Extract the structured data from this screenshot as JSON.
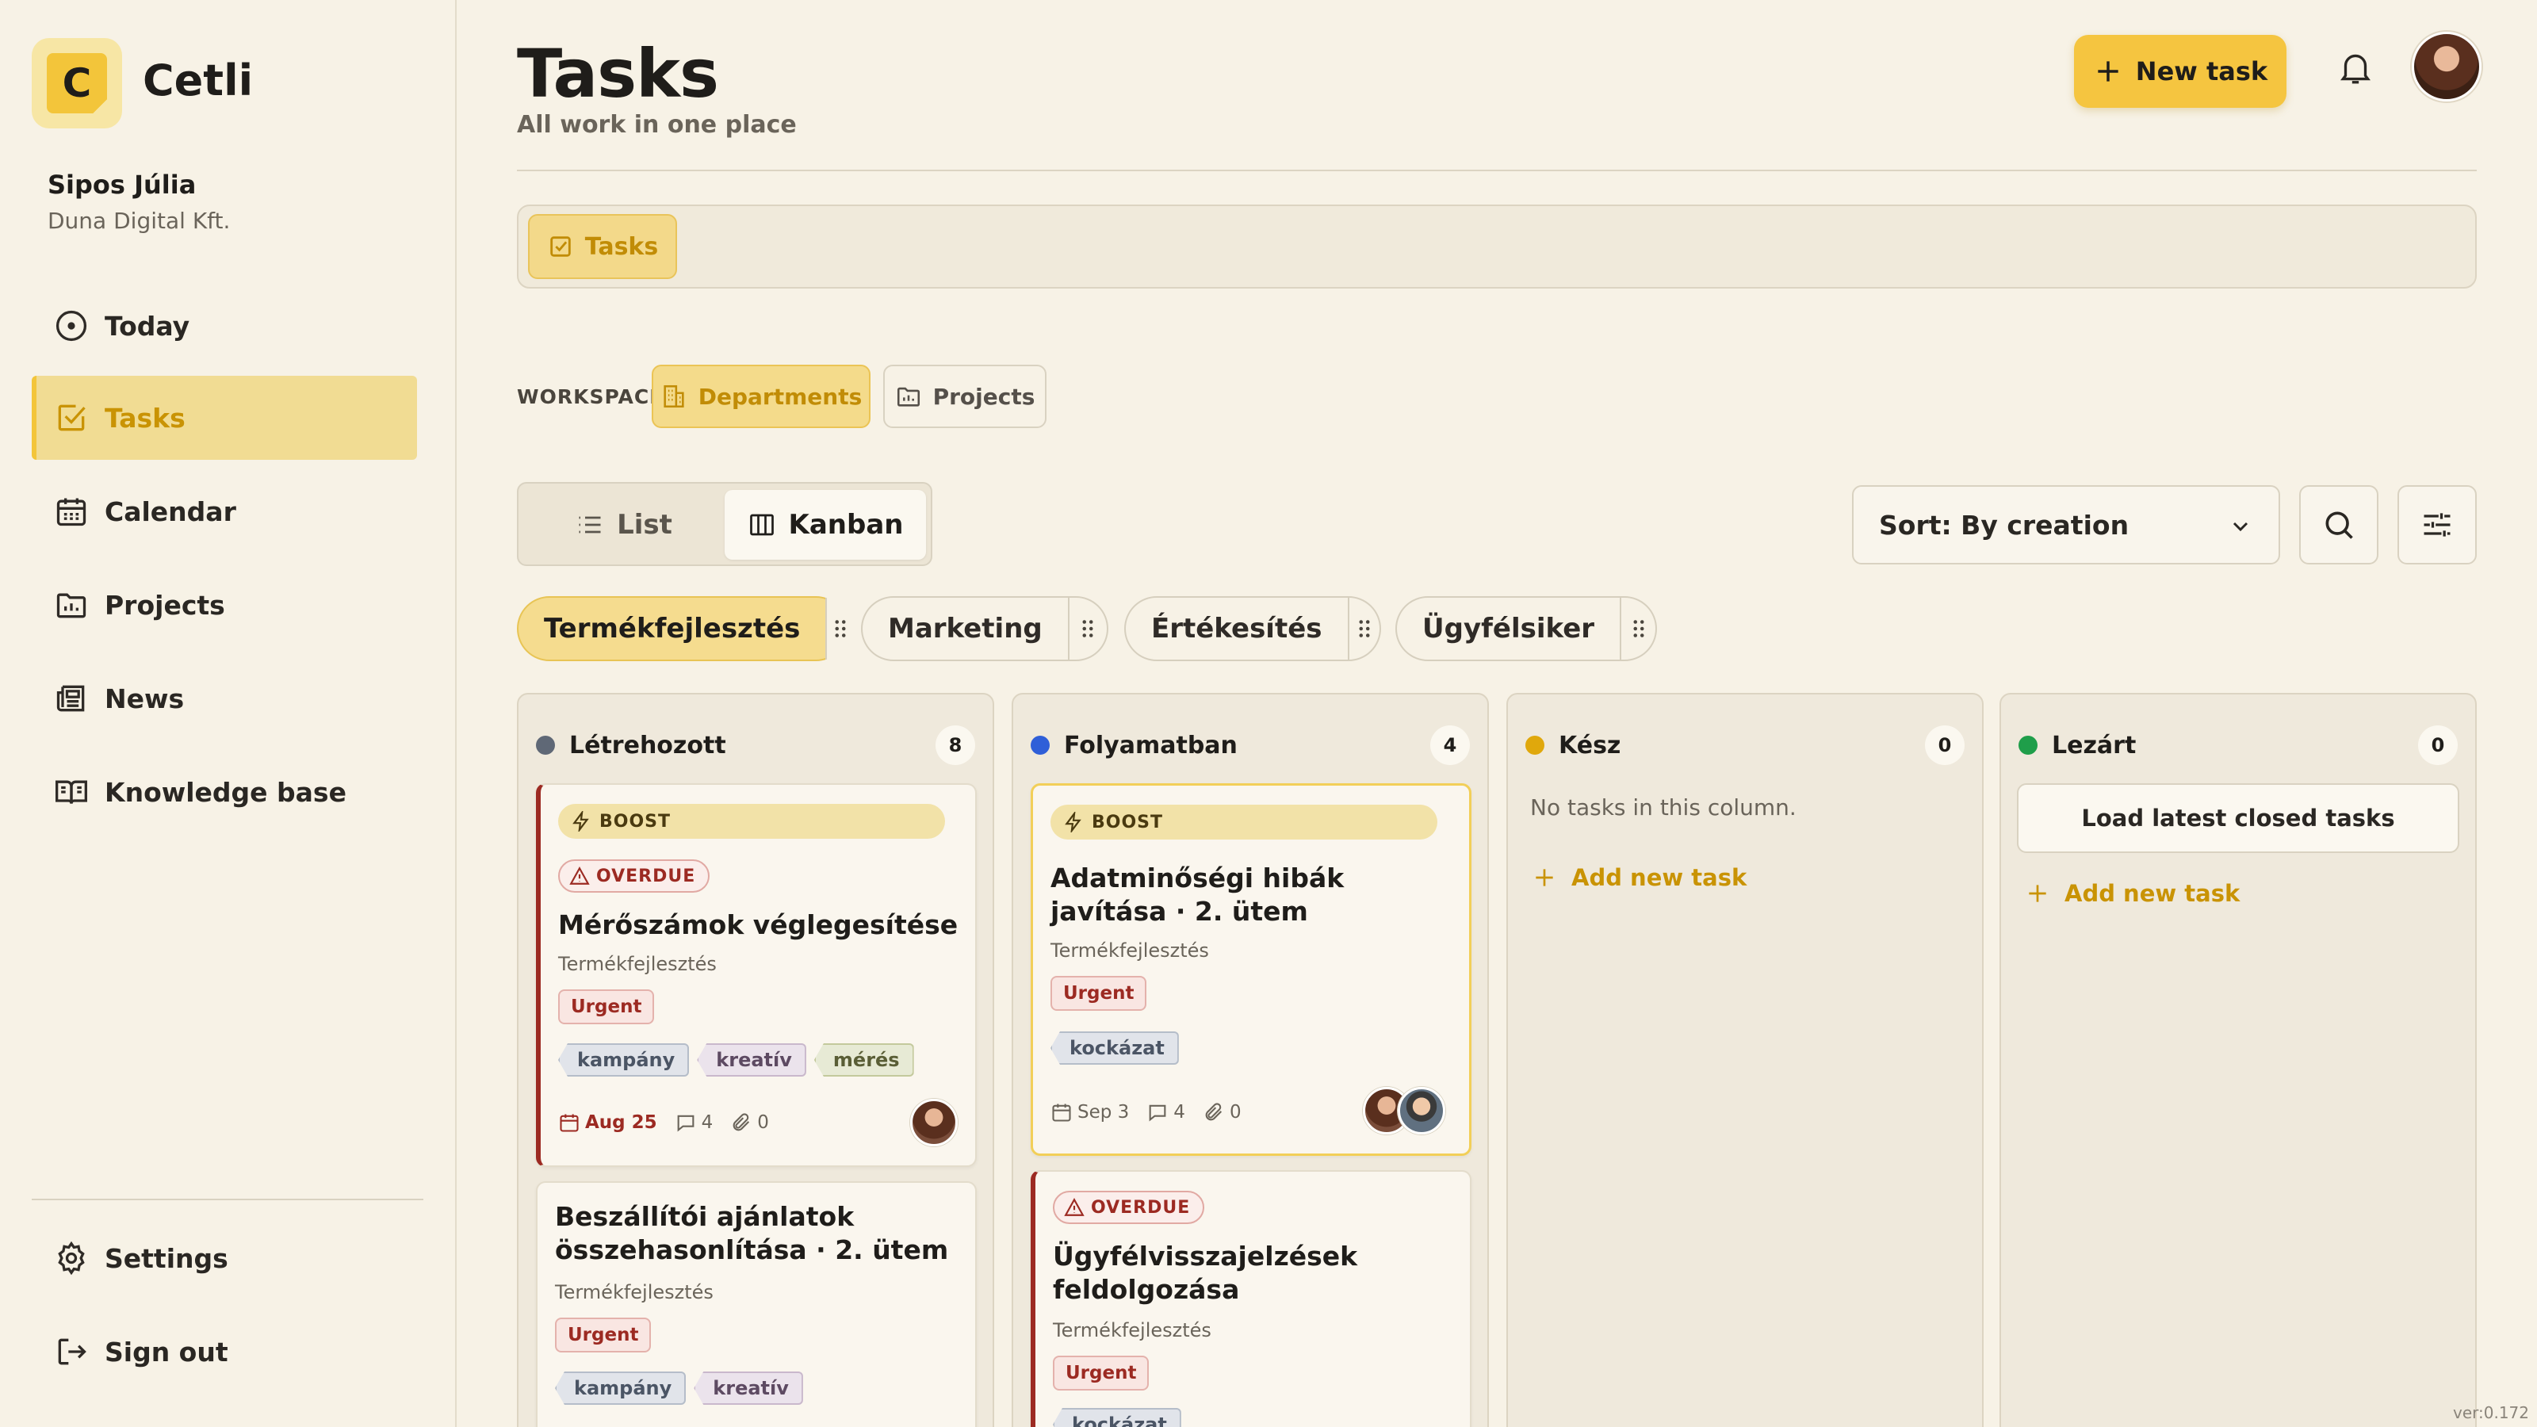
{
  "app": {
    "name": "Cetli",
    "logo_letter": "C",
    "version": "ver:0.172"
  },
  "user": {
    "name": "Sipos Júlia",
    "company": "Duna Digital Kft."
  },
  "sidebar": {
    "items": [
      {
        "label": "Today",
        "icon": "clock-icon"
      },
      {
        "label": "Tasks",
        "icon": "checkbox-icon",
        "active": true
      },
      {
        "label": "Calendar",
        "icon": "calendar-icon"
      },
      {
        "label": "Projects",
        "icon": "folder-chart-icon"
      },
      {
        "label": "News",
        "icon": "newspaper-icon"
      },
      {
        "label": "Knowledge base",
        "icon": "book-icon"
      }
    ],
    "footer": [
      {
        "label": "Settings",
        "icon": "gear-icon"
      },
      {
        "label": "Sign out",
        "icon": "logout-icon"
      }
    ]
  },
  "header": {
    "title": "Tasks",
    "subtitle": "All work in one place",
    "new_task_label": "New task"
  },
  "tabbar": {
    "tabs": [
      {
        "label": "Tasks"
      }
    ]
  },
  "workspace": {
    "label": "WORKSPACE",
    "options": [
      "Departments",
      "Projects"
    ],
    "selected": "Departments"
  },
  "view": {
    "options": [
      "List",
      "Kanban"
    ],
    "selected": "Kanban"
  },
  "sort": {
    "label": "Sort: By creation"
  },
  "departments": {
    "tabs": [
      "Termékfejlesztés",
      "Marketing",
      "Értékesítés",
      "Ügyfélsiker"
    ],
    "active": "Termékfejlesztés"
  },
  "columns": [
    {
      "title": "Létrehozott",
      "count": "8",
      "color": "#5f6876",
      "cards": [
        {
          "boost": "BOOST",
          "overdue": "OVERDUE",
          "title": "Mérőszámok véglegesítése",
          "dept": "Termékfejlesztés",
          "priority": "Urgent",
          "tags": [
            "kampány",
            "kreatív",
            "mérés"
          ],
          "due": "Aug 25",
          "comments": "4",
          "attachments": "0"
        },
        {
          "title": "Beszállítói ajánlatok összehasonlítása · 2. ütem",
          "dept": "Termékfejlesztés",
          "priority": "Urgent",
          "tags": [
            "kampány",
            "kreatív"
          ]
        }
      ]
    },
    {
      "title": "Folyamatban",
      "count": "4",
      "color": "#2f5fd8",
      "cards": [
        {
          "boost": "BOOST",
          "title": "Adatminőségi hibák javítása · 2. ütem",
          "dept": "Termékfejlesztés",
          "priority": "Urgent",
          "tags": [
            "kockázat"
          ],
          "due": "Sep 3",
          "comments": "4",
          "attachments": "0"
        },
        {
          "overdue": "OVERDUE",
          "title": "Ügyfélvisszajelzések feldolgozása",
          "dept": "Termékfejlesztés",
          "priority": "Urgent",
          "tags": [
            "kockázat"
          ]
        }
      ]
    },
    {
      "title": "Kész",
      "count": "0",
      "color": "#e0a80c",
      "empty_text": "No tasks in this column.",
      "add_label": "Add new task"
    },
    {
      "title": "Lezárt",
      "count": "0",
      "color": "#1f9e4a",
      "load_label": "Load latest closed tasks",
      "add_label": "Add new task"
    }
  ]
}
